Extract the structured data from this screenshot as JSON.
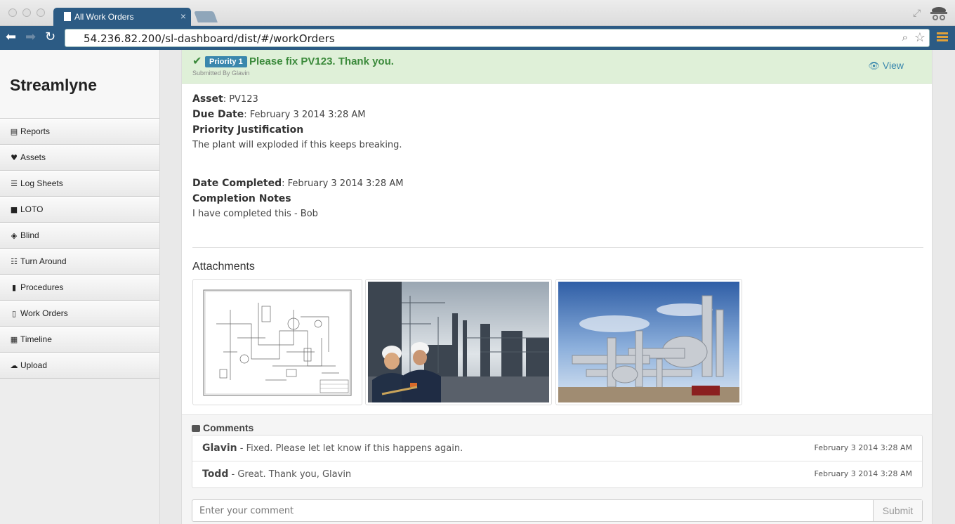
{
  "browser": {
    "tab_title": "All Work Orders",
    "url": "54.236.82.200/sl-dashboard/dist/#/workOrders"
  },
  "sidebar": {
    "brand": "Streamlyne",
    "items": [
      {
        "label": "Reports",
        "icon": "list-alt-icon",
        "glyph": "▤"
      },
      {
        "label": "Assets",
        "icon": "heart-icon",
        "glyph": "♥"
      },
      {
        "label": "Log Sheets",
        "icon": "list-icon",
        "glyph": "☰"
      },
      {
        "label": "LOTO",
        "icon": "lock-icon",
        "glyph": "🔒"
      },
      {
        "label": "Blind",
        "icon": "eye-slash-icon",
        "glyph": "◈"
      },
      {
        "label": "Turn Around",
        "icon": "server-icon",
        "glyph": "☷"
      },
      {
        "label": "Procedures",
        "icon": "book-icon",
        "glyph": "▮"
      },
      {
        "label": "Work Orders",
        "icon": "file-icon",
        "glyph": "▯"
      },
      {
        "label": "Timeline",
        "icon": "calendar-icon",
        "glyph": "▦"
      },
      {
        "label": "Upload",
        "icon": "cloud-upload-icon",
        "glyph": "☁"
      }
    ]
  },
  "work_order": {
    "priority": "Priority 1",
    "title": "Please fix PV123. Thank you.",
    "submitted_by": "Submitted By Glavin",
    "view_label": "View",
    "asset_label": "Asset",
    "asset_value": "PV123",
    "due_label": "Due Date",
    "due_value": "February 3 2014 3:28 AM",
    "justification_label": "Priority Justification",
    "justification_value": "The plant will exploded if this keeps breaking.",
    "completed_label": "Date Completed",
    "completed_value": "February 3 2014 3:28 AM",
    "notes_label": "Completion Notes",
    "notes_value": "I have completed this - Bob"
  },
  "attachments": {
    "heading": "Attachments",
    "items": [
      {
        "name": "piping-diagram"
      },
      {
        "name": "refinery-workers-photo"
      },
      {
        "name": "refinery-pipes-photo"
      }
    ]
  },
  "comments": {
    "heading": "Comments",
    "items": [
      {
        "author": "Glavin",
        "text": " - Fixed. Please let let know if this happens again.",
        "date": "February 3 2014 3:28 AM"
      },
      {
        "author": "Todd",
        "text": " - Great. Thank you, Glavin",
        "date": "February 3 2014 3:28 AM"
      }
    ],
    "input_placeholder": "Enter your comment",
    "submit_label": "Submit"
  },
  "colors": {
    "browser_chrome": "#2c5b84",
    "alert_bg": "#dff0d8",
    "alert_text": "#3b8a3b",
    "badge": "#3a87ad",
    "link": "#3a87ad"
  }
}
